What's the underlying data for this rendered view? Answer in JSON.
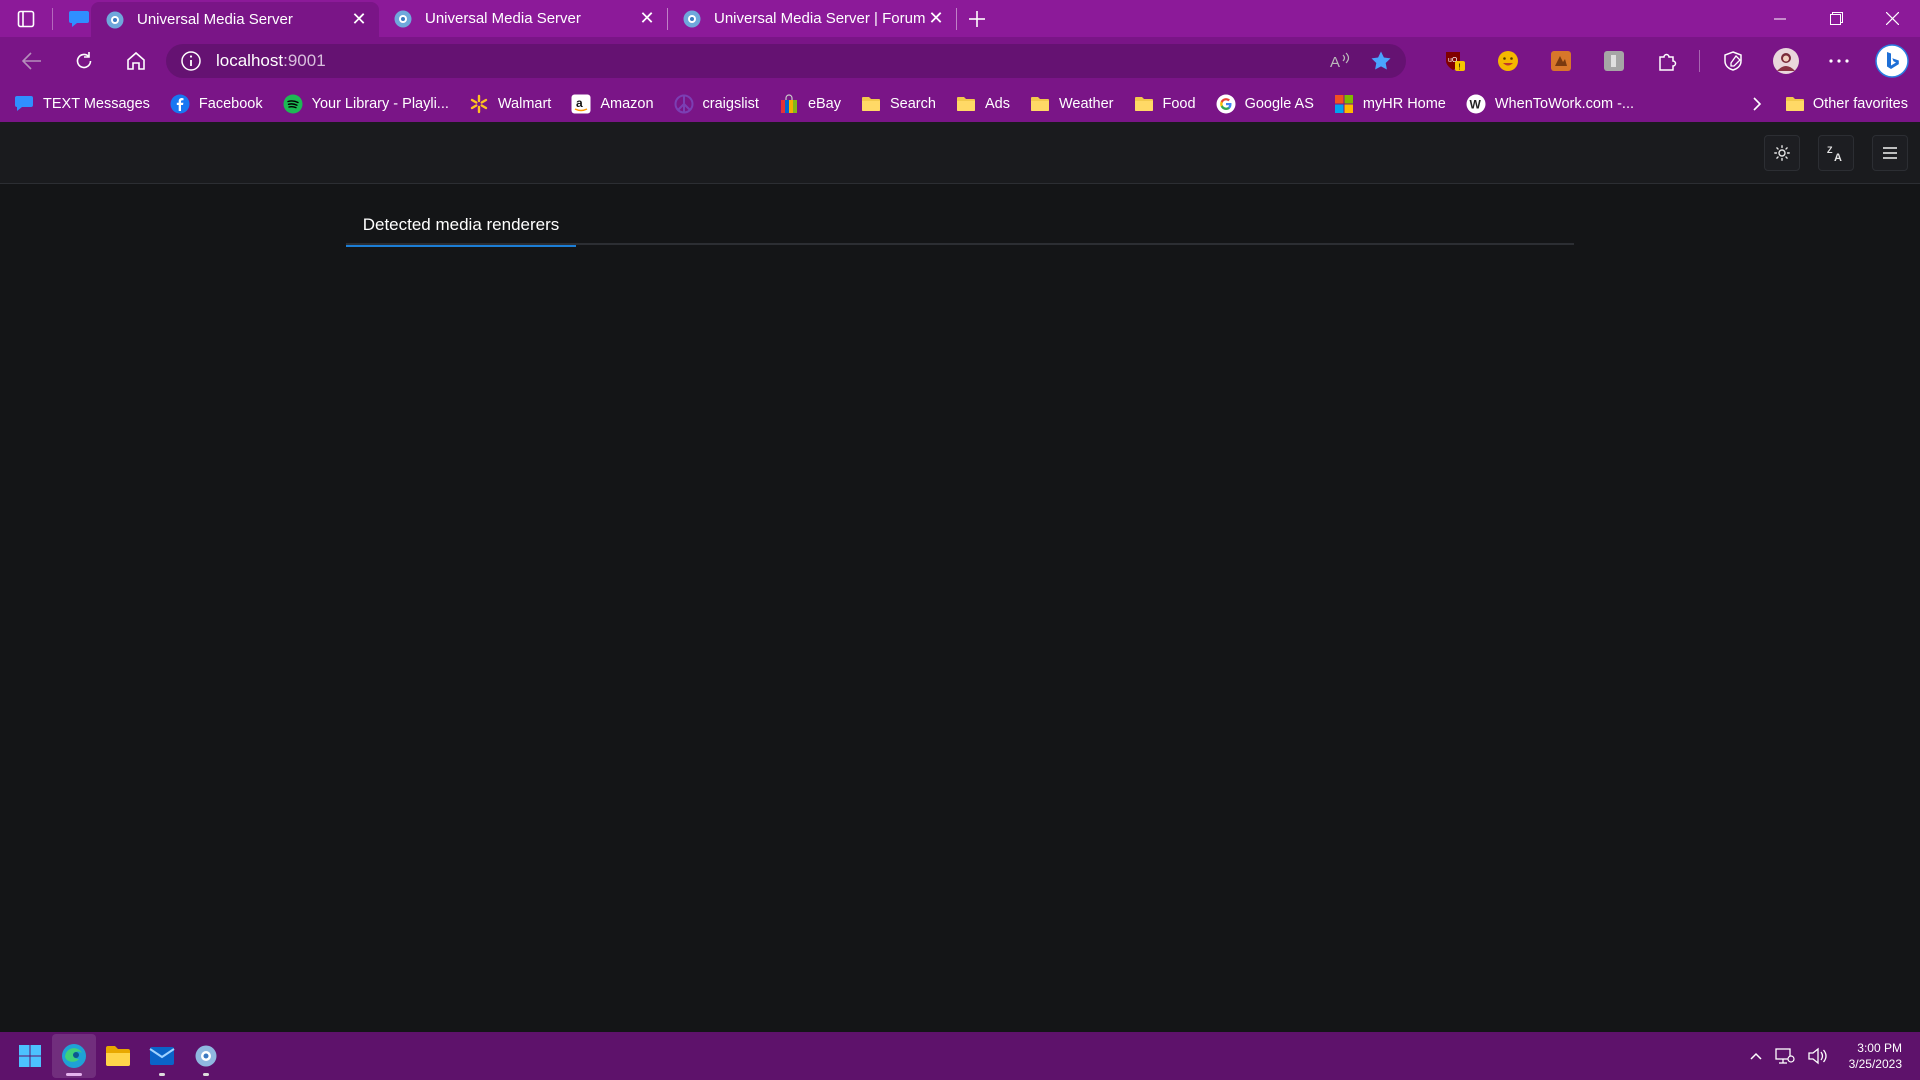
{
  "browser": {
    "tabs": [
      {
        "title": "Universal Media Server",
        "active": true
      },
      {
        "title": "Universal Media Server",
        "active": false
      },
      {
        "title": "Universal Media Server | Forum -",
        "active": false
      }
    ],
    "address": {
      "host": "localhost",
      "port": ":9001"
    },
    "bookmarks": [
      {
        "label": "TEXT Messages",
        "icon": "chat-bubble-icon"
      },
      {
        "label": "Facebook",
        "icon": "facebook-icon"
      },
      {
        "label": "Your Library - Playli...",
        "icon": "spotify-icon"
      },
      {
        "label": "Walmart",
        "icon": "walmart-spark-icon"
      },
      {
        "label": "Amazon",
        "icon": "amazon-icon"
      },
      {
        "label": "craigslist",
        "icon": "peace-icon"
      },
      {
        "label": "eBay",
        "icon": "ebay-bag-icon"
      },
      {
        "label": "Search",
        "icon": "folder-icon"
      },
      {
        "label": "Ads",
        "icon": "folder-icon"
      },
      {
        "label": "Weather",
        "icon": "folder-icon"
      },
      {
        "label": "Food",
        "icon": "folder-icon"
      },
      {
        "label": "Google AS",
        "icon": "google-icon"
      },
      {
        "label": "myHR Home",
        "icon": "microsoft-icon"
      },
      {
        "label": "WhenToWork.com -...",
        "icon": "w-circle-icon"
      }
    ],
    "other_favorites": "Other favorites"
  },
  "app": {
    "tab_label": "Detected media renderers"
  },
  "taskbar": {
    "time": "3:00 PM",
    "date": "3/25/2023"
  },
  "colors": {
    "browser_frame": "#8c1a99",
    "page_background": "#141517",
    "tab_accent": "#1c7ed6",
    "taskbar": "#5e126b"
  }
}
